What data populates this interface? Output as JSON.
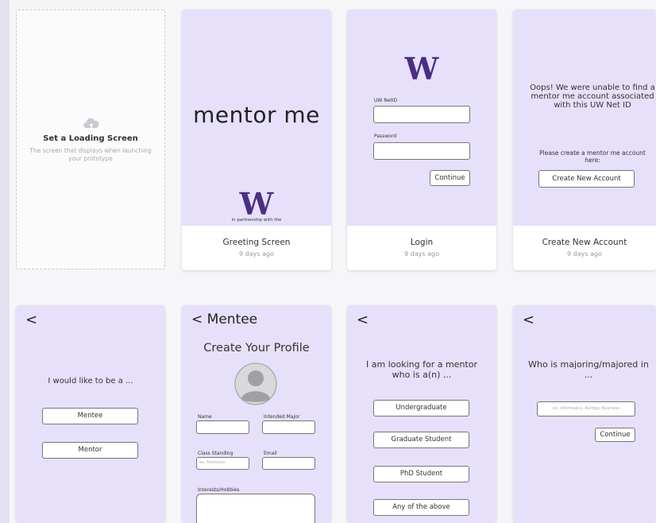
{
  "loading": {
    "title": "Set a Loading Screen",
    "description": "The screen that displays when launching your prototype"
  },
  "greeting": {
    "logo_text": "mentor me",
    "w_logo": "W",
    "partnership": "in partnership with the",
    "name": "Greeting Screen",
    "time": "9 days ago"
  },
  "login": {
    "w_logo": "W",
    "netid_label": "UW NetID",
    "password_label": "Password",
    "continue": "Continue",
    "name": "Login",
    "time": "9 days ago"
  },
  "create_account": {
    "message": "Oops! We were unable to find a mentor me account associated with this UW Net ID",
    "prompt": "Please create a mentor me account here:",
    "button": "Create New Account",
    "name": "Create New Account",
    "time": "9 days ago"
  },
  "role_select": {
    "back": "<",
    "question": "I would like to be a ...",
    "options": [
      "Mentee",
      "Mentor"
    ]
  },
  "profile": {
    "back": "< Mentee",
    "title": "Create Your Profile",
    "name_label": "Name",
    "major_label": "Intended Major",
    "standing_label": "Class Standing",
    "standing_placeholder": "ex. freshman",
    "email_label": "Email",
    "interests_label": "Interests/Hobbies"
  },
  "looking_for": {
    "back": "<",
    "question": "I am looking for a mentor who is a(n) ...",
    "options": [
      "Undergraduate",
      "Graduate Student",
      "PhD Student",
      "Any of the above"
    ]
  },
  "majoring": {
    "back": "<",
    "question": "Who is majoring/majored in ...",
    "placeholder": "ex. Informatics, Biology, Business",
    "continue": "Continue"
  },
  "colors": {
    "preview_bg": "#e7e0fa",
    "uw_purple": "#4b2e83"
  }
}
